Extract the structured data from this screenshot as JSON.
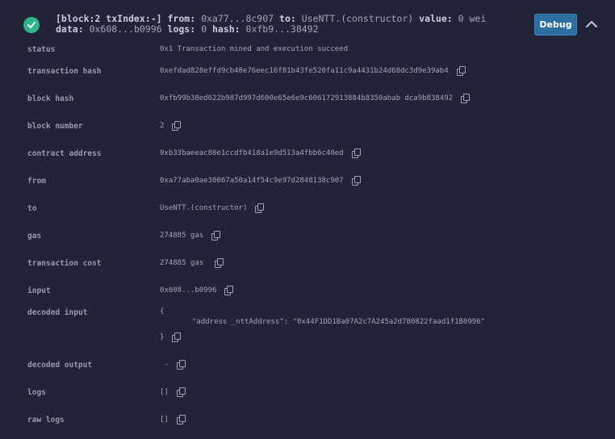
{
  "header": {
    "summary_line1_prefix": "[block:2 txIndex:-]",
    "from_key": "from:",
    "from_value": "0xa77...8c907",
    "to_key": "to:",
    "to_value": "UseNTT.(constructor)",
    "value_key": "value:",
    "value_value": "0 wei",
    "data_key": "data:",
    "data_value": "0x608...b0996",
    "logs_key": "logs:",
    "logs_value": "0",
    "hash_key": "hash:",
    "hash_value": "0xfb9...38492",
    "debug_label": "Debug",
    "status_icon": "check-circle-icon",
    "collapse_icon": "chevron-up-icon"
  },
  "rows": {
    "status": {
      "label": "status",
      "value": "0x1 Transaction mined and execution succeed"
    },
    "tx_hash": {
      "label": "transaction hash",
      "value": "0xefdad828effd9cb48e76eec16f81b43fe520fa11c9a4431b24d68dc3d9e39ab4"
    },
    "block_hash": {
      "label": "block hash",
      "value": "0xfb99b38ed622b987d997d600e65e6e9c606172913884b8350abab dca9b838492"
    },
    "block_number": {
      "label": "block number",
      "value": "2"
    },
    "contract_address": {
      "label": "contract address",
      "value": "0xb33baeeac80e1ccdfb418a1e9d513a4fbb6c40ed"
    },
    "from": {
      "label": "from",
      "value": "0xa77aba0ae30067a50a14f54c9e97d2848138c907"
    },
    "to": {
      "label": "to",
      "value": "UseNTT.(constructor)"
    },
    "gas": {
      "label": "gas",
      "value": "274885 gas"
    },
    "tx_cost": {
      "label": "transaction cost",
      "value": "274885 gas"
    },
    "input": {
      "label": "input",
      "value": "0x608...b0996"
    },
    "decoded_input": {
      "label": "decoded input",
      "open": "{",
      "line": "\"address _nttAddress\": \"0x44F1DD1Ba07A2c7A245a2d780822faad1f1B0996\"",
      "close": "}"
    },
    "decoded_output": {
      "label": "decoded output",
      "value": "-"
    },
    "logs": {
      "label": "logs",
      "value": "[]"
    },
    "raw_logs": {
      "label": "raw logs",
      "value": "[]"
    }
  }
}
